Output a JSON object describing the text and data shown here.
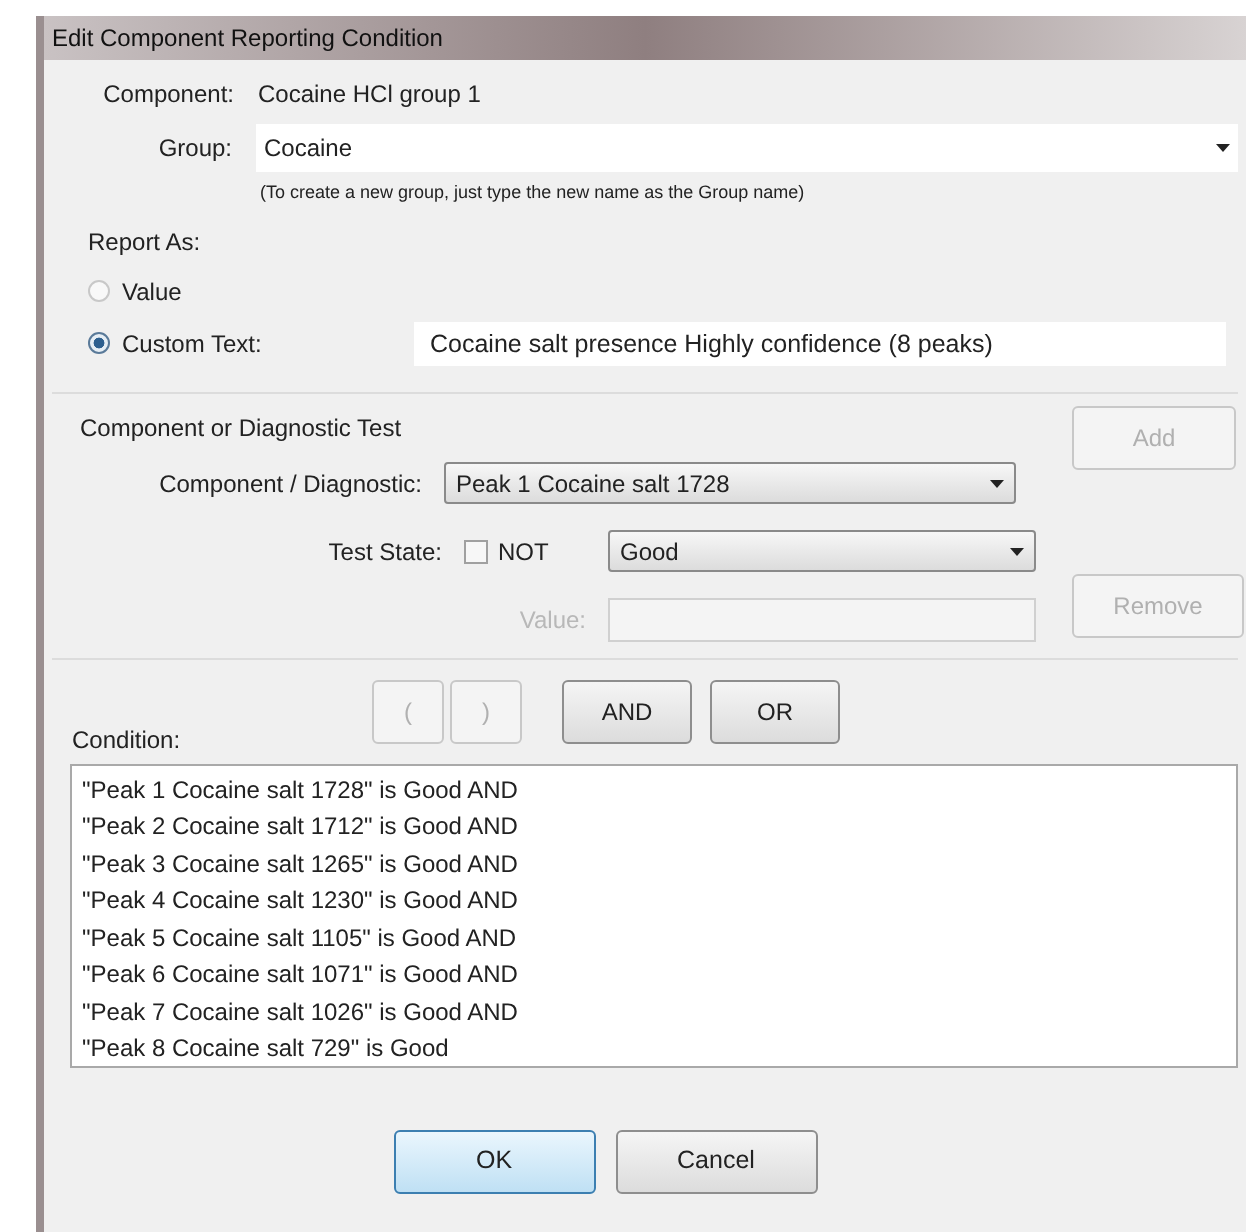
{
  "window": {
    "title": "Edit Component Reporting Condition"
  },
  "component": {
    "label": "Component:",
    "value": "Cocaine HCl group 1"
  },
  "group": {
    "label": "Group:",
    "value": "Cocaine",
    "hint": "(To create a new group, just type the new name as the Group name)"
  },
  "report_as": {
    "label": "Report As:",
    "options": [
      {
        "label": "Value",
        "selected": false
      },
      {
        "label": "Custom Text:",
        "selected": true
      }
    ],
    "custom_text": "Cocaine salt presence Highly confidence (8 peaks)"
  },
  "test": {
    "title": "Component or Diagnostic Test",
    "component_diagnostic": {
      "label": "Component / Diagnostic:",
      "value": "Peak 1 Cocaine salt 1728"
    },
    "test_state": {
      "label": "Test State:",
      "not_label": "NOT",
      "not_checked": false,
      "value": "Good"
    },
    "value": {
      "label": "Value:",
      "disabled": true
    },
    "add": {
      "label": "Add",
      "disabled": true
    },
    "remove": {
      "label": "Remove",
      "disabled": true
    }
  },
  "operators": [
    {
      "label": "(",
      "disabled": true
    },
    {
      "label": ")",
      "disabled": true
    },
    {
      "label": "AND",
      "disabled": false
    },
    {
      "label": "OR",
      "disabled": false
    }
  ],
  "condition": {
    "label": "Condition:",
    "lines": [
      "\"Peak 1 Cocaine salt 1728\" is Good AND",
      "\"Peak 2 Cocaine salt 1712\" is Good AND",
      "\"Peak 3 Cocaine salt 1265\" is Good AND",
      "\"Peak 4 Cocaine salt 1230\" is Good AND",
      "\"Peak 5 Cocaine salt 1105\" is Good AND",
      "\"Peak 6 Cocaine salt 1071\" is Good AND",
      "\"Peak 7 Cocaine salt 1026\" is Good AND",
      "\"Peak 8 Cocaine salt 729\" is Good"
    ]
  },
  "buttons": [
    {
      "label": "OK",
      "kind": "default"
    },
    {
      "label": "Cancel",
      "kind": "normal"
    }
  ]
}
